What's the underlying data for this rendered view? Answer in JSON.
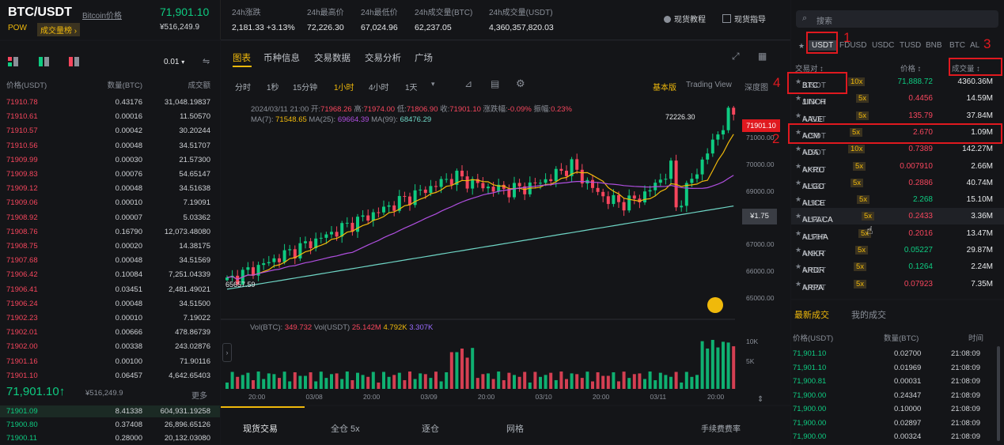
{
  "header": {
    "pair": "BTC/USDT",
    "link": "Bitcoin价格",
    "tag": "POW",
    "rank": "成交量榜 ›",
    "price": "71,901.10",
    "price_fiat": "¥516,249.9"
  },
  "stats": [
    {
      "label": "24h涨跌",
      "value": "2,181.33 +3.13%",
      "color": "green"
    },
    {
      "label": "24h最高价",
      "value": "72,226.30",
      "color": "white"
    },
    {
      "label": "24h最低价",
      "value": "67,024.96",
      "color": "white"
    },
    {
      "label": "24h成交量(BTC)",
      "value": "62,237.05",
      "color": "white"
    },
    {
      "label": "24h成交量(USDT)",
      "value": "4,360,357,820.03",
      "color": "white"
    }
  ],
  "top_links": {
    "tutorial": "现货教程",
    "guide": "现货指导"
  },
  "orderbook": {
    "precision": "0.01",
    "headers": {
      "price": "价格(USDT)",
      "qty": "数量(BTC)",
      "total": "成交额"
    },
    "asks": [
      [
        "71910.78",
        "0.43176",
        "31,048.19837"
      ],
      [
        "71910.61",
        "0.00016",
        "11.50570"
      ],
      [
        "71910.57",
        "0.00042",
        "30.20244"
      ],
      [
        "71910.56",
        "0.00048",
        "34.51707"
      ],
      [
        "71909.99",
        "0.00030",
        "21.57300"
      ],
      [
        "71909.83",
        "0.00076",
        "54.65147"
      ],
      [
        "71909.12",
        "0.00048",
        "34.51638"
      ],
      [
        "71909.06",
        "0.00010",
        "7.19091"
      ],
      [
        "71908.92",
        "0.00007",
        "5.03362"
      ],
      [
        "71908.76",
        "0.16790",
        "12,073.48080"
      ],
      [
        "71908.75",
        "0.00020",
        "14.38175"
      ],
      [
        "71907.68",
        "0.00048",
        "34.51569"
      ],
      [
        "71906.42",
        "0.10084",
        "7,251.04339"
      ],
      [
        "71906.41",
        "0.03451",
        "2,481.49021"
      ],
      [
        "71906.24",
        "0.00048",
        "34.51500"
      ],
      [
        "71902.23",
        "0.00010",
        "7.19022"
      ],
      [
        "71902.01",
        "0.00666",
        "478.86739"
      ],
      [
        "71902.00",
        "0.00338",
        "243.02876"
      ],
      [
        "71901.16",
        "0.00100",
        "71.90116"
      ],
      [
        "71901.10",
        "0.06457",
        "4,642.65403"
      ]
    ],
    "last_price": "71,901.10",
    "last_arrow": "↑",
    "last_fiat": "¥516,249.9",
    "more": "更多",
    "bids": [
      [
        "71901.09",
        "8.41338",
        "604,931.19258"
      ],
      [
        "71900.80",
        "0.37408",
        "26,896.65126"
      ],
      [
        "71900.11",
        "0.28000",
        "20,132.03080"
      ]
    ]
  },
  "chart_tabs": {
    "chart": "图表",
    "info": "币种信息",
    "trade_data": "交易数据",
    "analysis": "交易分析",
    "square": "广场"
  },
  "timeframes": [
    "分时",
    "1秒",
    "15分钟",
    "1小时",
    "4小时",
    "1天"
  ],
  "timeframe_active": "1小时",
  "views": {
    "basic": "基本版",
    "tradingview": "Trading View",
    "depth": "深度图"
  },
  "ohlc_line": {
    "date": "2024/03/11 21:00",
    "open_label": "开:",
    "open": "71968.26",
    "high_label": "高:",
    "high": "71974.00",
    "low_label": "低:",
    "low": "71806.90",
    "close_label": "收:",
    "close": "71901.10",
    "chg_label": "涨跌幅:",
    "chg": "-0.09%",
    "amp_label": "振幅:",
    "amp": "0.23%"
  },
  "ma_line": {
    "ma7_label": "MA(7):",
    "ma7": "71548.65",
    "ma25_label": "MA(25):",
    "ma25": "69664.39",
    "ma99_label": "MA(99):",
    "ma99": "68476.29"
  },
  "vol_line": {
    "vbtc_label": "Vol(BTC):",
    "vbtc": "349.732",
    "vusdt_label": "Vol(USDT)",
    "vusdt": "25.142M",
    "v1": "4.792K",
    "v2": "3.307K"
  },
  "chart_labels": {
    "high_mark": "72226.30",
    "low_mark": "65657.59",
    "current": "71901.10",
    "cursor": "¥1.75"
  },
  "y_axis": [
    "71000.00",
    "70000.00",
    "69000.00",
    "68000.00",
    "67000.00",
    "66000.00",
    "65000.00"
  ],
  "vol_axis": [
    "10K",
    "5K"
  ],
  "x_axis": [
    "20:00",
    "03/08",
    "20:00",
    "03/09",
    "20:00",
    "03/10",
    "20:00",
    "03/11",
    "20:00"
  ],
  "chart_data": {
    "type": "candlestick",
    "x_range": [
      "03/07 20:00",
      "03/11 21:00"
    ],
    "ylim": [
      65000,
      72226.3
    ],
    "high": 72226.3,
    "low": 65657.59,
    "last_close": 71901.1,
    "ma": {
      "ma7": 71548.65,
      "ma25": 69664.39,
      "ma99": 68476.29
    },
    "y_ticks": [
      71000,
      70000,
      69000,
      68000,
      67000,
      66000,
      65000
    ]
  },
  "trade_tabs": [
    "现货交易",
    "全仓 5x",
    "逐仓",
    "网格"
  ],
  "fee_link": "手续费费率",
  "market": {
    "search_placeholder": "搜索",
    "quote_tabs": [
      "USDT",
      "FDUSD",
      "USDC",
      "TUSD",
      "BNB",
      "BTC",
      "AL"
    ],
    "headers": {
      "pair": "交易对 ↕",
      "price": "价格 ↕",
      "volume": "成交量 ↕"
    },
    "rows": [
      {
        "base": "BTC",
        "quote": "/USDT",
        "lev": "10x",
        "price": "71,888.72",
        "color": "green",
        "vol": "4360.36M"
      },
      {
        "base": "1INCH",
        "quote": "/USDT",
        "lev": "5x",
        "price": "0.4456",
        "color": "red",
        "vol": "14.59M"
      },
      {
        "base": "AAVE",
        "quote": "/USDT",
        "lev": "5x",
        "price": "135.79",
        "color": "red",
        "vol": "37.84M"
      },
      {
        "base": "ACM",
        "quote": "/USDT",
        "lev": "5x",
        "price": "2.670",
        "color": "red",
        "vol": "1.09M"
      },
      {
        "base": "ADA",
        "quote": "/USDT",
        "lev": "10x",
        "price": "0.7389",
        "color": "red",
        "vol": "142.27M"
      },
      {
        "base": "AKRO",
        "quote": "/USDT",
        "lev": "5x",
        "price": "0.007910",
        "color": "red",
        "vol": "2.66M"
      },
      {
        "base": "ALGO",
        "quote": "/USDT",
        "lev": "5x",
        "price": "0.2886",
        "color": "red",
        "vol": "40.74M"
      },
      {
        "base": "ALICE",
        "quote": "/USDT",
        "lev": "5x",
        "price": "2.268",
        "color": "green",
        "vol": "15.10M"
      },
      {
        "base": "ALPACA",
        "quote": "/USDT",
        "lev": "5x",
        "price": "0.2433",
        "color": "red",
        "vol": "3.36M"
      },
      {
        "base": "ALPHA",
        "quote": "/USDT",
        "lev": "5x",
        "price": "0.2016",
        "color": "red",
        "vol": "13.47M"
      },
      {
        "base": "ANKR",
        "quote": "/USDT",
        "lev": "5x",
        "price": "0.05227",
        "color": "green",
        "vol": "29.87M"
      },
      {
        "base": "ARDR",
        "quote": "/USDT",
        "lev": "5x",
        "price": "0.1264",
        "color": "green",
        "vol": "2.24M"
      },
      {
        "base": "ARPA",
        "quote": "/USDT",
        "lev": "5x",
        "price": "0.07923",
        "color": "red",
        "vol": "7.35M"
      }
    ]
  },
  "trades": {
    "tab_latest": "最新成交",
    "tab_mine": "我的成交",
    "headers": {
      "price": "价格(USDT)",
      "qty": "数量(BTC)",
      "time": "时间"
    },
    "rows": [
      [
        "71,901.10",
        "0.02700",
        "21:08:09"
      ],
      [
        "71,901.10",
        "0.01969",
        "21:08:09"
      ],
      [
        "71,900.81",
        "0.00031",
        "21:08:09"
      ],
      [
        "71,900.00",
        "0.24347",
        "21:08:09"
      ],
      [
        "71,900.00",
        "0.10000",
        "21:08:09"
      ],
      [
        "71,900.00",
        "0.02897",
        "21:08:09"
      ],
      [
        "71,900.00",
        "0.00324",
        "21:08:09"
      ]
    ]
  },
  "annotations": [
    "1",
    "2",
    "3",
    "4"
  ]
}
